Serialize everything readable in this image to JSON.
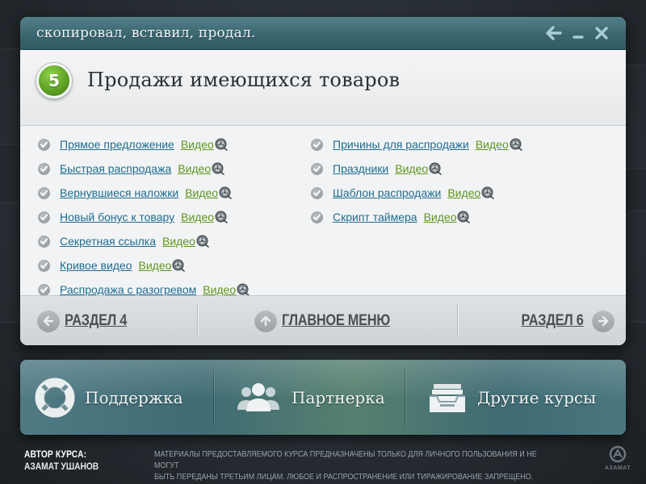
{
  "window": {
    "title": "скопировал, вставил, продал."
  },
  "header": {
    "badge_number": "5",
    "title": "Продажи имеющихся товаров"
  },
  "lessons": {
    "video_label": "Видео",
    "left": [
      {
        "title": "Прямое предложение"
      },
      {
        "title": "Быстрая распродажа"
      },
      {
        "title": "Вернувшиеся наложки"
      },
      {
        "title": "Новый бонус к товару"
      },
      {
        "title": "Секретная ссылка"
      },
      {
        "title": "Кривое видео"
      },
      {
        "title": "Распродажа с разогревом"
      }
    ],
    "right": [
      {
        "title": "Причины для распродажи"
      },
      {
        "title": "Праздники"
      },
      {
        "title": "Шаблон распродажи"
      },
      {
        "title": "Скрипт таймера"
      }
    ]
  },
  "navigation": {
    "prev_label": "РАЗДЕЛ 4",
    "main_label": "ГЛАВНОЕ МЕНЮ",
    "next_label": "РАЗДЕЛ 6"
  },
  "bottom_menu": {
    "support_label": "Поддержка",
    "partner_label": "Партнерка",
    "courses_label": "Другие курсы"
  },
  "footer": {
    "author_heading": "АВТОР КУРСА:",
    "author_name": "АЗАМАТ УШАНОВ",
    "disclaimer_line1": "МАТЕРИАЛЫ ПРЕДОСТАВЛЯЕМОГО КУРСА ПРЕДНАЗНАЧЕНЫ ТОЛЬКО ДЛЯ ЛИЧНОГО ПОЛЬЗОВАНИЯ И НЕ МОГУТ",
    "disclaimer_line2": "БЫТЬ ПЕРЕДАНЫ ТРЕТЬИМ ЛИЦАМ. ЛЮБОЕ И РАСПРОСТРАНЕНИЕ ИЛИ ТИРАЖИРОВАНИЕ ЗАПРЕЩЕНО.",
    "logo_text": "АЗАМАТ"
  },
  "colors": {
    "titlebar": "#3b6670",
    "link": "#1d6c91",
    "video_link": "#5f961f",
    "badge": "#5fa325"
  },
  "icons": {
    "window": [
      "back-arrow-icon",
      "minimize-icon",
      "close-icon"
    ],
    "lesson": [
      "check-icon",
      "video-reel-icon"
    ],
    "nav": [
      "arrow-left-icon",
      "arrow-up-icon",
      "arrow-right-icon"
    ],
    "bottom": [
      "lifebuoy-icon",
      "people-icon",
      "inbox-tray-icon"
    ]
  }
}
